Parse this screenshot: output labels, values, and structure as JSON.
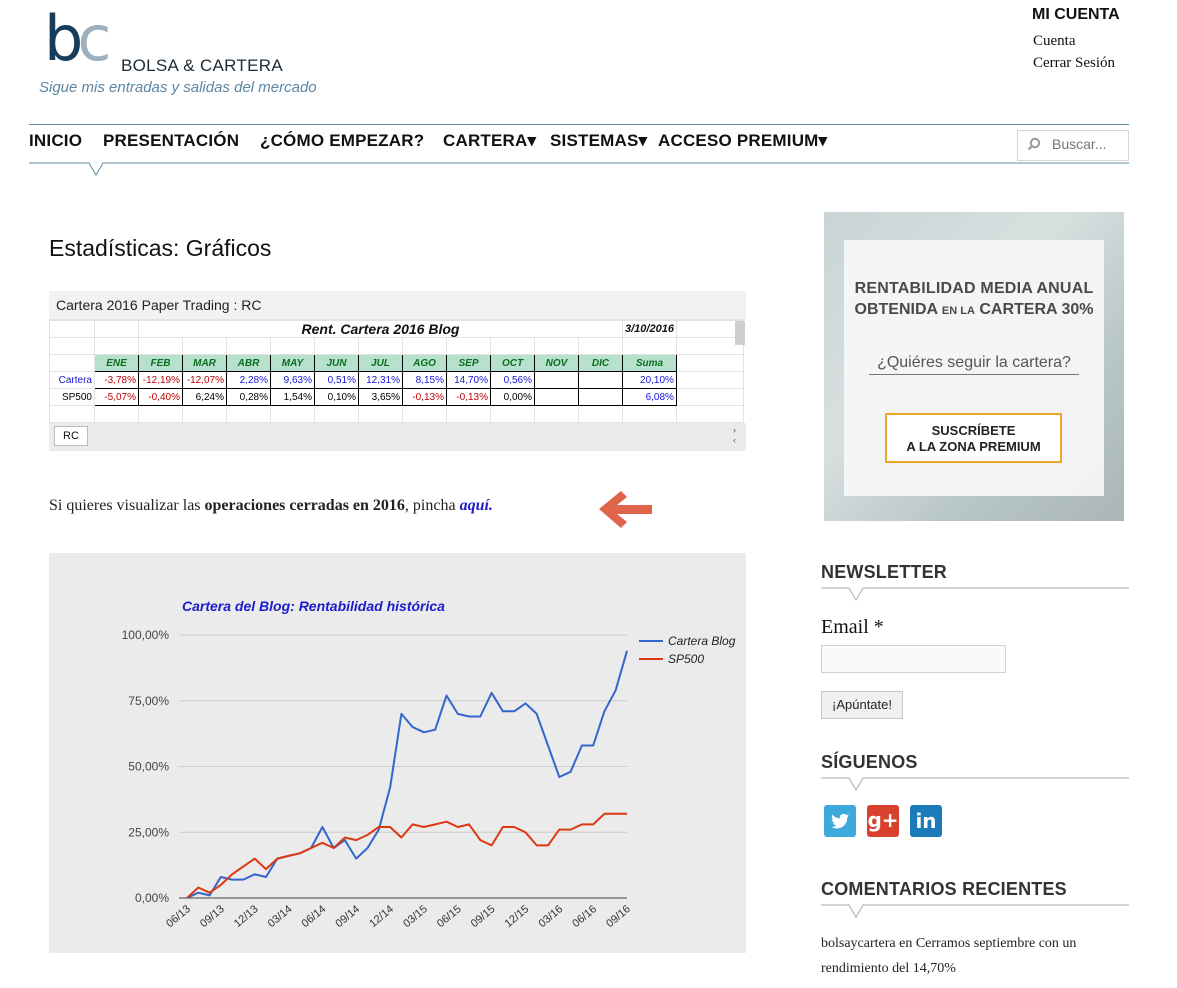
{
  "header": {
    "logo_b": "b",
    "logo_c": "c",
    "site_name": "BOLSA & CARTERA",
    "tagline": "Sigue mis entradas y salidas del mercado",
    "account_title": "MI CUENTA",
    "account_links": [
      "Cuenta",
      "Cerrar Sesión"
    ]
  },
  "nav": {
    "items": [
      "INICIO",
      "PRESENTACIÓN",
      "¿CÓMO EMPEZAR?",
      "CARTERA▾",
      "SISTEMAS▾",
      "ACCESO PREMIUM▾"
    ],
    "search_placeholder": "Buscar..."
  },
  "page_title": "Estadísticas: Gráficos",
  "sheet": {
    "title": "Cartera 2016 Paper Trading : RC",
    "heading": "Rent. Cartera 2016 Blog",
    "date": "3/10/2016",
    "months": [
      "ENE",
      "FEB",
      "MAR",
      "ABR",
      "MAY",
      "JUN",
      "JUL",
      "AGO",
      "SEP",
      "OCT",
      "NOV",
      "DIC",
      "Suma"
    ],
    "rows": [
      {
        "label": "Cartera",
        "cells": [
          "-3,78%",
          "-12,19%",
          "-12,07%",
          "2,28%",
          "9,63%",
          "0,51%",
          "12,31%",
          "8,15%",
          "14,70%",
          "0,56%",
          "",
          "",
          "20,10%"
        ]
      },
      {
        "label": "SP500",
        "cells": [
          "-5,07%",
          "-0,40%",
          "6,24%",
          "0,28%",
          "1,54%",
          "0,10%",
          "3,65%",
          "-0,13%",
          "-0,13%",
          "0,00%",
          "",
          "",
          "6,08%"
        ]
      }
    ],
    "tab": "RC"
  },
  "sentence": {
    "prefix": "Si quieres visualizar las ",
    "bold": "operaciones cerradas en 2016",
    "middle": ", pincha ",
    "link": "aquí."
  },
  "chart_data": {
    "type": "line",
    "title": "Cartera del Blog: Rentabilidad histórica",
    "xlabel": "",
    "ylabel": "",
    "ylim": [
      0,
      100
    ],
    "yticks": [
      "0,00%",
      "25,00%",
      "50,00%",
      "75,00%",
      "100,00%"
    ],
    "xtick_labels": [
      "06/13",
      "09/13",
      "12/13",
      "03/14",
      "06/14",
      "09/14",
      "12/14",
      "03/15",
      "06/15",
      "09/15",
      "12/15",
      "03/16",
      "06/16",
      "09/16"
    ],
    "grid": true,
    "legend": "right",
    "x": [
      0,
      1,
      2,
      3,
      4,
      5,
      6,
      7,
      8,
      9,
      10,
      11,
      12,
      13,
      14,
      15,
      16,
      17,
      18,
      19,
      20,
      21,
      22,
      23,
      24,
      25,
      26,
      27,
      28,
      29,
      30,
      31,
      32,
      33,
      34,
      35,
      36,
      37,
      38,
      39
    ],
    "series": [
      {
        "name": "Cartera Blog",
        "color": "#3366cc",
        "values": [
          0,
          2,
          1,
          8,
          7,
          7,
          9,
          8,
          15,
          16,
          17,
          19,
          27,
          19,
          22,
          15,
          19,
          26,
          42,
          70,
          65,
          63,
          64,
          77,
          70,
          69,
          69,
          78,
          71,
          71,
          74,
          70,
          58,
          46,
          48,
          58,
          58,
          71,
          79,
          94
        ]
      },
      {
        "name": "SP500",
        "color": "#dc3912",
        "values": [
          0,
          4,
          2,
          5,
          9,
          12,
          15,
          11,
          15,
          16,
          17,
          19,
          21,
          19,
          23,
          22,
          24,
          27,
          27,
          23,
          28,
          27,
          28,
          29,
          27,
          28,
          22,
          20,
          27,
          27,
          25,
          20,
          20,
          26,
          26,
          28,
          28,
          32,
          32,
          32
        ]
      }
    ]
  },
  "promo": {
    "line1": "RENTABILIDAD MEDIA ANUAL",
    "line2a": "OBTENIDA ",
    "line2b": "EN LA",
    "line2c": " CARTERA 30%",
    "question": "¿Quiéres seguir la cartera?",
    "button1": "SUSCRÍBETE",
    "button2": "A LA ZONA PREMIUM"
  },
  "newsletter": {
    "heading": "NEWSLETTER",
    "email_label": "Email *",
    "button": "¡Apúntate!"
  },
  "follow": {
    "heading": "SÍGUENOS",
    "icons": [
      "twitter-icon",
      "google-plus-icon",
      "linkedin-icon"
    ],
    "gplus_text": "g+",
    "linkedin_text": "in"
  },
  "comments": {
    "heading": "COMENTARIOS RECIENTES",
    "author": "bolsaycartera",
    "connector": " en ",
    "post": "Cerramos septiembre con un rendimiento del 14,70%"
  }
}
